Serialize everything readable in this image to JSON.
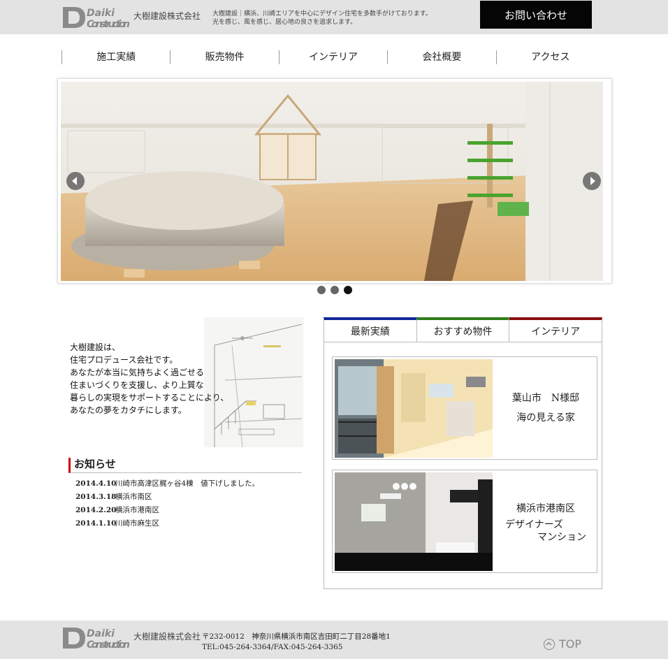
{
  "header": {
    "logo_text_1": "Daiki",
    "logo_text_2": "Construction",
    "company_name": "大樹建設株式会社",
    "tagline_line1": "大樹建設｜横浜、川崎エリアを中心にデザイン住宅を多数手がけております。",
    "tagline_line2": "光を感じ、風を感じ、居心地の良さを追求します。",
    "contact_label": "お問い合わせ"
  },
  "nav": {
    "items": [
      {
        "label": "施工実績"
      },
      {
        "label": "販売物件"
      },
      {
        "label": "インテリア"
      },
      {
        "label": "会社概要"
      },
      {
        "label": "アクセス"
      }
    ]
  },
  "slider": {
    "slide_count": 3,
    "active_index": 2
  },
  "intro": {
    "text": "大樹建設は、\n住宅プロデュース会社です。\nあなたが本当に気持ちよく過ごせる\n住まいづくりを支援し、より上質な\n暮らしの実現をサポートすることにより、\nあなたの夢をカタチにします。"
  },
  "news": {
    "title": "お知らせ",
    "items": [
      {
        "date": "2014.4.10",
        "text": "川崎市高津区梶ヶ谷4棟　値下げしました。"
      },
      {
        "date": "2014.3.18",
        "text": "横浜市南区"
      },
      {
        "date": "2014.2.20",
        "text": "横浜市港南区"
      },
      {
        "date": "2014.1.10",
        "text": "川崎市麻生区"
      }
    ]
  },
  "tabs": {
    "items": [
      {
        "label": "最新実績",
        "color": "#12279a"
      },
      {
        "label": "おすすめ物件",
        "color": "#2e7d1a"
      },
      {
        "label": "インテリア",
        "color": "#8a1010"
      }
    ]
  },
  "cards": [
    {
      "line1": "葉山市　N様邸",
      "line2": "海の見える家"
    },
    {
      "line1": "横浜市港南区",
      "line2": "デザイナーズ",
      "line3": "マンション"
    }
  ],
  "footer": {
    "company_name": "大樹建設株式会社",
    "address": "〒232-0012　神奈川県横浜市南区吉田町二丁目28番地1",
    "tel": "TEL:045-264-3364/FAX:045-264-3365",
    "top_label": "TOP"
  }
}
